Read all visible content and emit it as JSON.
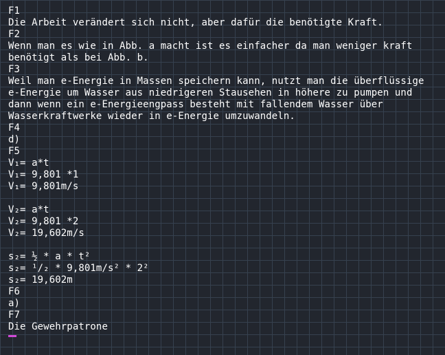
{
  "editor": {
    "lines": [
      "F1",
      "Die Arbeit verändert sich nicht, aber dafür die benötigte Kraft.",
      "F2",
      "Wenn man es wie in Abb. a macht ist es einfacher da man weniger kraft",
      "benötigt als bei Abb. b.",
      "F3",
      "Weil man e-Energie in Massen speichern kann, nutzt man die überflüssige",
      "e-Energie um Wasser aus niedrigeren Stausehen in höhere zu pumpen und",
      "dann wenn ein e-Energieengpass besteht mit fallendem Wasser über",
      "Wasserkraftwerke wieder in e-Energie umzuwandeln.",
      "F4",
      "d)",
      "F5",
      "V₁= a*t",
      "V₁= 9,801 *1",
      "V₁= 9,801m/s",
      "",
      "V₂= a*t",
      "V₂= 9,801 *2",
      "V₂= 19,602m/s",
      "",
      "s₂= ½ * a * t²",
      "s₂= ¹/₂ * 9,801m/s² * 2²",
      "s₂= 19,602m",
      "F6",
      "a)",
      "F7",
      "Die Gewehrpatrone"
    ],
    "cursor_color": "#d04ad6"
  }
}
